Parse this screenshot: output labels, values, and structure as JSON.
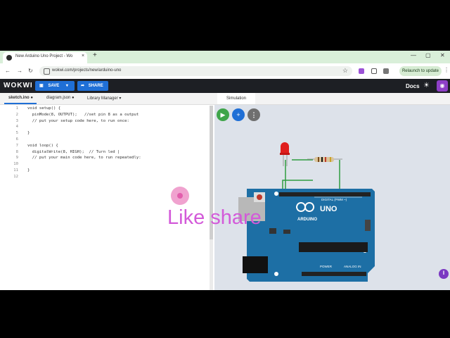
{
  "browser": {
    "tab_title": "New Arduino Uno Project - Wo",
    "tab_close": "×",
    "new_tab": "+",
    "window_controls": [
      "—",
      "▢",
      "✕"
    ],
    "url": "wokwi.com/projects/new/arduino-uno",
    "relaunch_label": "Relaunch to update",
    "menu_glyph": "⋮"
  },
  "app": {
    "logo": "WOKWI",
    "save_label": "SAVE",
    "share_label": "SHARE",
    "docs_label": "Docs",
    "accent": "#1f6fd6"
  },
  "editor": {
    "tabs": [
      {
        "label": "sketch.ino ●"
      },
      {
        "label": "diagram.json ●"
      },
      {
        "label": "Library Manager ▾"
      }
    ],
    "lines": [
      {
        "n": "1",
        "t": "void setup() {"
      },
      {
        "n": "2",
        "t": "  pinMode(8, OUTPUT);   //set pin 8 as a output"
      },
      {
        "n": "3",
        "t": "  // put your setup code here, to run once:"
      },
      {
        "n": "4",
        "t": ""
      },
      {
        "n": "5",
        "t": "}"
      },
      {
        "n": "6",
        "t": ""
      },
      {
        "n": "7",
        "t": "void loop() {"
      },
      {
        "n": "8",
        "t": "  digitalWrite(8, HIGH);  // Turn led |"
      },
      {
        "n": "9",
        "t": "  // put your main code here, to run repeatedly:"
      },
      {
        "n": "10",
        "t": ""
      },
      {
        "n": "11",
        "t": "}"
      },
      {
        "n": "12",
        "t": ""
      }
    ]
  },
  "simulation": {
    "tab_label": "Simulation",
    "board_logo_text": "UNO",
    "board_brand": "ARDUINO",
    "digital_label": "DIGITAL (PWM ~)",
    "power_label": "POWER",
    "analog_label": "ANALOG IN",
    "icons": [
      "play-icon",
      "plus-icon",
      "more-icon"
    ]
  },
  "overlay": {
    "text": "Like share"
  }
}
